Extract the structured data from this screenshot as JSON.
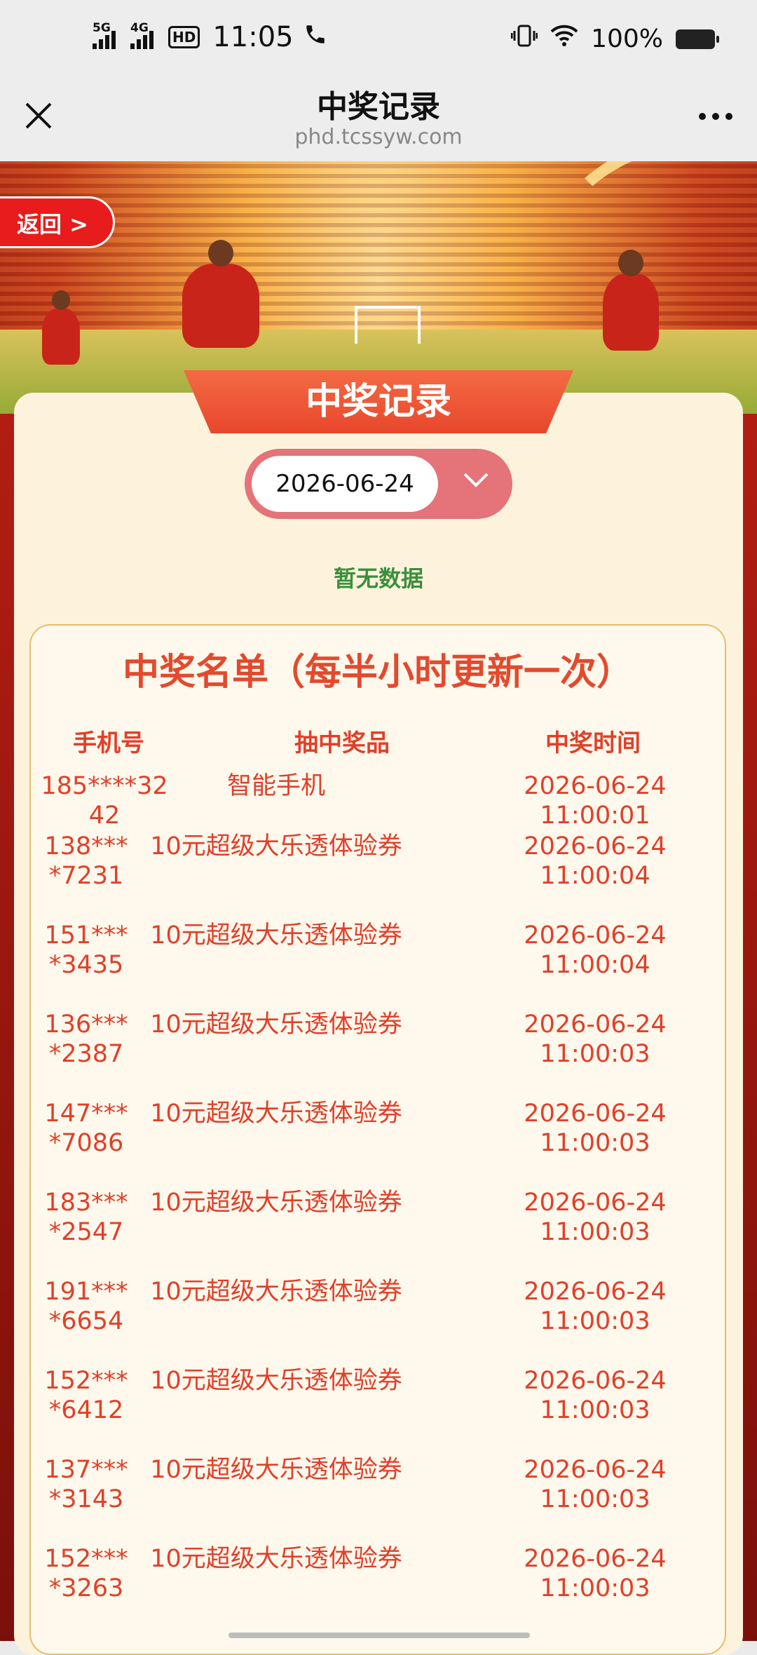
{
  "status_bar": {
    "net1": "5G",
    "net2": "4G",
    "hd": "HD",
    "time": "11:05",
    "battery": "100%"
  },
  "title_bar": {
    "title": "中奖记录",
    "url": "phd.tcssyw.com",
    "close_icon": "close-icon",
    "more_icon": "more-icon"
  },
  "page": {
    "back_label": "返回 >",
    "banner_title": "中奖记录",
    "date_value": "2026-06-24",
    "empty_text": "暂无数据",
    "list_title": "中奖名单（每半小时更新一次）",
    "headers": [
      "手机号",
      "抽中奖品",
      "中奖时间"
    ],
    "rows": [
      {
        "phone": "185****3242",
        "prize": "智能手机",
        "time": "2026-06-24 11:00:01"
      },
      {
        "phone": "138****7231",
        "prize": "10元超级大乐透体验券",
        "time": "2026-06-24 11:00:04"
      },
      {
        "phone": "151****3435",
        "prize": "10元超级大乐透体验券",
        "time": "2026-06-24 11:00:04"
      },
      {
        "phone": "136****2387",
        "prize": "10元超级大乐透体验券",
        "time": "2026-06-24 11:00:03"
      },
      {
        "phone": "147****7086",
        "prize": "10元超级大乐透体验券",
        "time": "2026-06-24 11:00:03"
      },
      {
        "phone": "183****2547",
        "prize": "10元超级大乐透体验券",
        "time": "2026-06-24 11:00:03"
      },
      {
        "phone": "191****6654",
        "prize": "10元超级大乐透体验券",
        "time": "2026-06-24 11:00:03"
      },
      {
        "phone": "152****6412",
        "prize": "10元超级大乐透体验券",
        "time": "2026-06-24 11:00:03"
      },
      {
        "phone": "137****3143",
        "prize": "10元超级大乐透体验券",
        "time": "2026-06-24 11:00:03"
      },
      {
        "phone": "152****3263",
        "prize": "10元超级大乐透体验券",
        "time": "2026-06-24 11:00:03"
      }
    ]
  },
  "colors": {
    "accent_red": "#e0402a",
    "card_bg": "#fdf3dc",
    "pill": "#e4737a",
    "empty_green": "#3b8f3b"
  }
}
